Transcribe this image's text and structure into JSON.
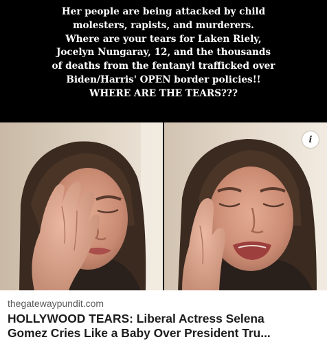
{
  "caption": {
    "lines": [
      "Her people are being attacked by child",
      "molesters, rapists, and murderers.",
      "Where are your tears for Laken Riely,",
      "Jocelyn Nungaray, 12, and the thousands",
      "of deaths from the fentanyl trafficked over",
      "Biden/Harris' OPEN border policies!!",
      "WHERE ARE THE TEARS???"
    ]
  },
  "info_icon": {
    "glyph": "i",
    "icon": "info-icon"
  },
  "link_preview": {
    "domain": "thegatewaypundit.com",
    "headline_lines": [
      "HOLLYWOOD TEARS: Liberal Actress Selena",
      "Gomez Cries Like a Baby Over President Tru..."
    ]
  },
  "colors": {
    "background": "#000000",
    "caption_text": "#ffffff",
    "card_background": "#ffffff",
    "domain_text": "#5a5a5a",
    "headline_text": "#1c1c1c"
  }
}
